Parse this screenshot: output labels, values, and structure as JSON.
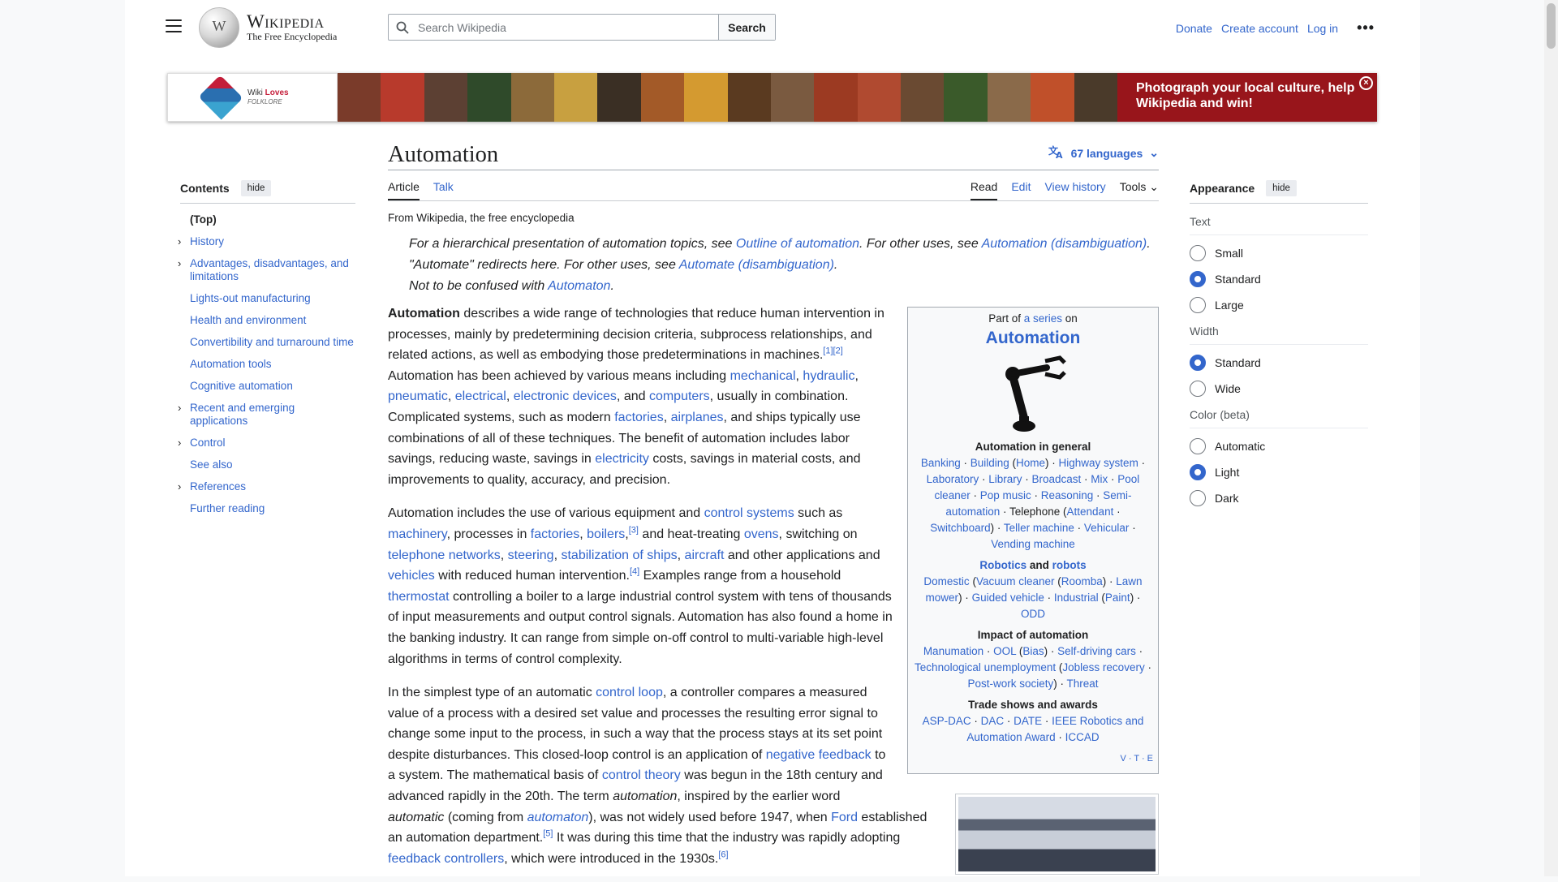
{
  "header": {
    "logo_title": "Wikipedia",
    "logo_tagline": "The Free Encyclopedia",
    "search_placeholder": "Search Wikipedia",
    "search_button": "Search",
    "donate": "Donate",
    "create_account": "Create account",
    "log_in": "Log in",
    "more": "•••"
  },
  "banner": {
    "brand_line1": "Wiki",
    "brand_line2": "Loves",
    "brand_line3": "FOLKLORE",
    "cta": "Photograph your local culture, help Wikipedia and win!",
    "strip_colors": [
      "#7a3b2a",
      "#b83a2c",
      "#5c4033",
      "#2f4a2a",
      "#8c6a3a",
      "#c8a040",
      "#3a2f24",
      "#a35a28",
      "#d49a30",
      "#5a3a20",
      "#7a5a40",
      "#9c3a22",
      "#b04a30",
      "#6a4a32",
      "#3a5a2a",
      "#8a6a4a",
      "#c0502a",
      "#4a3a2a"
    ]
  },
  "toc": {
    "title": "Contents",
    "hide": "hide",
    "items": [
      {
        "label": "(Top)",
        "expandable": false
      },
      {
        "label": "History",
        "expandable": true
      },
      {
        "label": "Advantages, disadvantages, and limitations",
        "expandable": true
      },
      {
        "label": "Lights-out manufacturing",
        "expandable": false
      },
      {
        "label": "Health and environment",
        "expandable": false
      },
      {
        "label": "Convertibility and turnaround time",
        "expandable": false
      },
      {
        "label": "Automation tools",
        "expandable": false
      },
      {
        "label": "Cognitive automation",
        "expandable": false
      },
      {
        "label": "Recent and emerging applications",
        "expandable": true
      },
      {
        "label": "Control",
        "expandable": true
      },
      {
        "label": "See also",
        "expandable": false
      },
      {
        "label": "References",
        "expandable": true
      },
      {
        "label": "Further reading",
        "expandable": false
      }
    ]
  },
  "article": {
    "title": "Automation",
    "languages": "67 languages",
    "tabs": {
      "article": "Article",
      "talk": "Talk",
      "read": "Read",
      "edit": "Edit",
      "history": "View history",
      "tools": "Tools"
    },
    "tagline": "From Wikipedia, the free encyclopedia",
    "hatnotes": [
      [
        {
          "t": "For a hierarchical presentation of automation topics, see "
        },
        {
          "t": "Outline of automation",
          "link": true
        },
        {
          "t": ". For other uses, see "
        },
        {
          "t": "Automation (disambiguation)",
          "link": true
        },
        {
          "t": "."
        }
      ],
      [
        {
          "t": "\"Automate\" redirects here. For other uses, see "
        },
        {
          "t": "Automate (disambiguation)",
          "link": true
        },
        {
          "t": "."
        }
      ],
      [
        {
          "t": "Not to be confused with "
        },
        {
          "t": "Automaton",
          "link": true
        },
        {
          "t": "."
        }
      ]
    ],
    "paragraphs": [
      [
        {
          "t": "Automation",
          "bold": true
        },
        {
          "t": " describes a wide range of technologies that reduce human intervention in processes, mainly by predetermining decision criteria, subprocess relationships, and related actions, as well as embodying those predeterminations in machines."
        },
        {
          "t": "[1][2]",
          "sup": true
        },
        {
          "t": " Automation has been achieved by various means including "
        },
        {
          "t": "mechanical",
          "link": true
        },
        {
          "t": ", "
        },
        {
          "t": "hydraulic",
          "link": true
        },
        {
          "t": ", "
        },
        {
          "t": "pneumatic",
          "link": true
        },
        {
          "t": ", "
        },
        {
          "t": "electrical",
          "link": true
        },
        {
          "t": ", "
        },
        {
          "t": "electronic devices",
          "link": true
        },
        {
          "t": ", and "
        },
        {
          "t": "computers",
          "link": true
        },
        {
          "t": ", usually in combination. Complicated systems, such as modern "
        },
        {
          "t": "factories",
          "link": true
        },
        {
          "t": ", "
        },
        {
          "t": "airplanes",
          "link": true
        },
        {
          "t": ", and ships typically use combinations of all of these techniques. The benefit of automation includes labor savings, reducing waste, savings in "
        },
        {
          "t": "electricity",
          "link": true
        },
        {
          "t": " costs, savings in material costs, and improvements to quality, accuracy, and precision."
        }
      ],
      [
        {
          "t": "Automation includes the use of various equipment and "
        },
        {
          "t": "control systems",
          "link": true
        },
        {
          "t": " such as "
        },
        {
          "t": "machinery",
          "link": true
        },
        {
          "t": ", processes in "
        },
        {
          "t": "factories",
          "link": true
        },
        {
          "t": ", "
        },
        {
          "t": "boilers",
          "link": true
        },
        {
          "t": ",",
          "link": false
        },
        {
          "t": "[3]",
          "sup": true
        },
        {
          "t": " and heat-treating "
        },
        {
          "t": "ovens",
          "link": true
        },
        {
          "t": ", switching on "
        },
        {
          "t": "telephone networks",
          "link": true
        },
        {
          "t": ", "
        },
        {
          "t": "steering",
          "link": true
        },
        {
          "t": ", "
        },
        {
          "t": "stabilization of ships",
          "link": true
        },
        {
          "t": ", "
        },
        {
          "t": "aircraft",
          "link": true
        },
        {
          "t": " and other applications and "
        },
        {
          "t": "vehicles",
          "link": true
        },
        {
          "t": " with reduced human intervention."
        },
        {
          "t": "[4]",
          "sup": true
        },
        {
          "t": " Examples range from a household "
        },
        {
          "t": "thermostat",
          "link": true
        },
        {
          "t": " controlling a boiler to a large industrial control system with tens of thousands of input measurements and output control signals. Automation has also found a home in the banking industry. It can range from simple on-off control to multi-variable high-level algorithms in terms of control complexity."
        }
      ],
      [
        {
          "t": "In the simplest type of an automatic "
        },
        {
          "t": "control loop",
          "link": true
        },
        {
          "t": ", a controller compares a measured value of a process with a desired set value and processes the resulting error signal to change some input to the process, in such a way that the process stays at its set point despite disturbances. This closed-loop control is an application of "
        },
        {
          "t": "negative feedback",
          "link": true
        },
        {
          "t": " to a system. The mathematical basis of "
        },
        {
          "t": "control theory",
          "link": true
        },
        {
          "t": " was begun in the 18th century and advanced rapidly in the 20th. The term "
        },
        {
          "t": "automation",
          "italic": true
        },
        {
          "t": ", inspired by the earlier word "
        },
        {
          "t": "automatic",
          "italic": true
        },
        {
          "t": " (coming from "
        },
        {
          "t": "automaton",
          "link": true,
          "italic": true
        },
        {
          "t": "), was not widely used before 1947, when "
        },
        {
          "t": "Ford",
          "link": true
        },
        {
          "t": " established an automation department."
        },
        {
          "t": "[5]",
          "sup": true
        },
        {
          "t": " It was during this time that the industry was rapidly adopting "
        },
        {
          "t": "feedback controllers",
          "link": true
        },
        {
          "t": ", which were introduced in the 1930s."
        },
        {
          "t": "[6]",
          "sup": true
        }
      ]
    ]
  },
  "infobox": {
    "part_of_pre": "Part of ",
    "part_of_link": "a series",
    "part_of_post": " on",
    "title": "Automation",
    "image_icon": "robot-arm-icon",
    "sections": [
      {
        "heading": [
          {
            "t": "Automation in general"
          }
        ],
        "body": [
          {
            "t": "Banking",
            "link": true
          },
          {
            "t": " · "
          },
          {
            "t": "Building",
            "link": true
          },
          {
            "t": " ("
          },
          {
            "t": "Home",
            "link": true
          },
          {
            "t": ") · "
          },
          {
            "t": "Highway system",
            "link": true
          },
          {
            "t": " · "
          },
          {
            "t": "Laboratory",
            "link": true
          },
          {
            "t": " · "
          },
          {
            "t": "Library",
            "link": true
          },
          {
            "t": " · "
          },
          {
            "t": "Broadcast",
            "link": true
          },
          {
            "t": " · "
          },
          {
            "t": "Mix",
            "link": true
          },
          {
            "t": " · "
          },
          {
            "t": "Pool cleaner",
            "link": true
          },
          {
            "t": " · "
          },
          {
            "t": "Pop music",
            "link": true
          },
          {
            "t": " · "
          },
          {
            "t": "Reasoning",
            "link": true
          },
          {
            "t": " · "
          },
          {
            "t": "Semi-automation",
            "link": true
          },
          {
            "t": " · Telephone ("
          },
          {
            "t": "Attendant",
            "link": true
          },
          {
            "t": " · "
          },
          {
            "t": "Switchboard",
            "link": true
          },
          {
            "t": ") · "
          },
          {
            "t": "Teller machine",
            "link": true
          },
          {
            "t": " · "
          },
          {
            "t": "Vehicular",
            "link": true
          },
          {
            "t": " · "
          },
          {
            "t": "Vending machine",
            "link": true
          }
        ]
      },
      {
        "heading": [
          {
            "t": "Robotics",
            "link": true
          },
          {
            "t": " and "
          },
          {
            "t": "robots",
            "link": true
          }
        ],
        "body": [
          {
            "t": "Domestic",
            "link": true
          },
          {
            "t": " ("
          },
          {
            "t": "Vacuum cleaner",
            "link": true
          },
          {
            "t": " ("
          },
          {
            "t": "Roomba",
            "link": true
          },
          {
            "t": ") · "
          },
          {
            "t": "Lawn mower",
            "link": true
          },
          {
            "t": ") · "
          },
          {
            "t": "Guided vehicle",
            "link": true
          },
          {
            "t": " · "
          },
          {
            "t": "Industrial",
            "link": true
          },
          {
            "t": " ("
          },
          {
            "t": "Paint",
            "link": true
          },
          {
            "t": ") · "
          },
          {
            "t": "ODD",
            "link": true
          }
        ]
      },
      {
        "heading": [
          {
            "t": "Impact of automation"
          }
        ],
        "body": [
          {
            "t": "Manumation",
            "link": true
          },
          {
            "t": " · "
          },
          {
            "t": "OOL",
            "link": true
          },
          {
            "t": " ("
          },
          {
            "t": "Bias",
            "link": true
          },
          {
            "t": ") · "
          },
          {
            "t": "Self-driving cars",
            "link": true
          },
          {
            "t": " · "
          },
          {
            "t": "Technological unemployment",
            "link": true
          },
          {
            "t": " ("
          },
          {
            "t": "Jobless recovery",
            "link": true
          },
          {
            "t": " · "
          },
          {
            "t": "Post-work society",
            "link": true
          },
          {
            "t": ") · "
          },
          {
            "t": "Threat",
            "link": true
          }
        ]
      },
      {
        "heading": [
          {
            "t": "Trade shows and awards"
          }
        ],
        "body": [
          {
            "t": "ASP-DAC",
            "link": true
          },
          {
            "t": " · "
          },
          {
            "t": "DAC",
            "link": true
          },
          {
            "t": " · "
          },
          {
            "t": "DATE",
            "link": true
          },
          {
            "t": " · "
          },
          {
            "t": "IEEE Robotics and Automation Award",
            "link": true
          },
          {
            "t": " · "
          },
          {
            "t": "ICCAD",
            "link": true
          }
        ]
      }
    ],
    "vte": "V · T · E"
  },
  "appearance": {
    "title": "Appearance",
    "hide": "hide",
    "groups": [
      {
        "label": "Text",
        "options": [
          {
            "label": "Small",
            "selected": false
          },
          {
            "label": "Standard",
            "selected": true
          },
          {
            "label": "Large",
            "selected": false
          }
        ]
      },
      {
        "label": "Width",
        "options": [
          {
            "label": "Standard",
            "selected": true
          },
          {
            "label": "Wide",
            "selected": false
          }
        ]
      },
      {
        "label": "Color (beta)",
        "options": [
          {
            "label": "Automatic",
            "selected": false
          },
          {
            "label": "Light",
            "selected": true
          },
          {
            "label": "Dark",
            "selected": false
          }
        ]
      }
    ]
  },
  "colors": {
    "link": "#3366cc",
    "accent": "#3366cc",
    "banner_cta_bg": "#98151b"
  }
}
